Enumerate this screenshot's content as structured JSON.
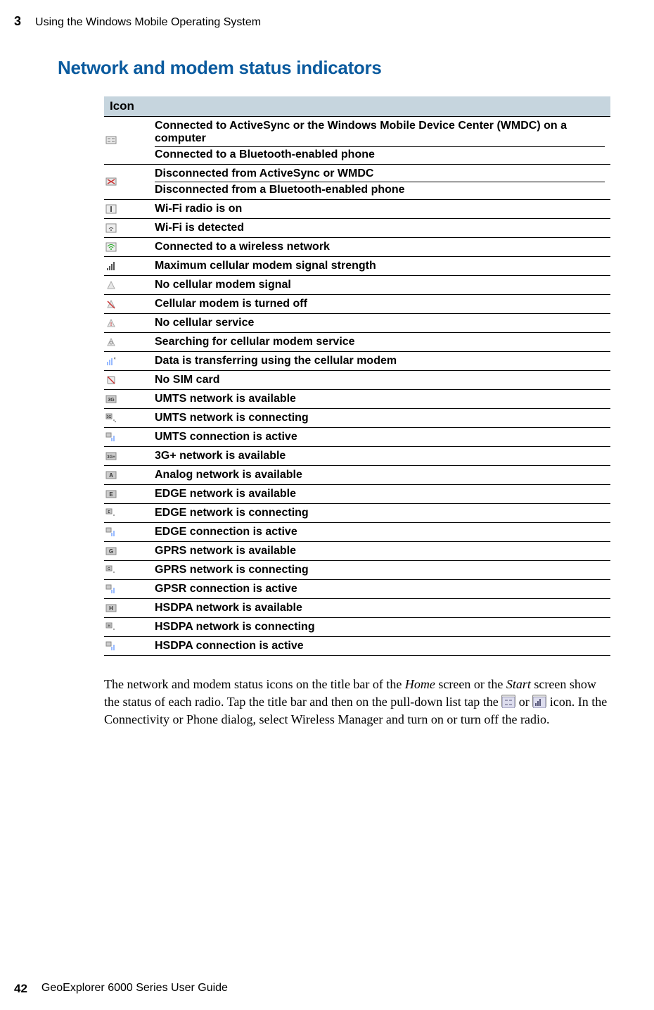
{
  "chapter_num": "3",
  "chapter_title": "Using the Windows Mobile Operating System",
  "section_title": "Network and modem status indicators",
  "table_header": "Icon",
  "rows": [
    {
      "desc_a": "Connected to ActiveSync or the Windows Mobile Device Center (WMDC) on a computer",
      "desc_b": "Connected to a Bluetooth-enabled phone"
    },
    {
      "desc_a": "Disconnected from ActiveSync or WMDC",
      "desc_b": "Disconnected from a Bluetooth-enabled phone"
    },
    {
      "desc": "Wi-Fi radio is on"
    },
    {
      "desc": "Wi-Fi is detected"
    },
    {
      "desc": "Connected to a wireless network"
    },
    {
      "desc": "Maximum cellular modem signal strength"
    },
    {
      "desc": "No cellular modem signal"
    },
    {
      "desc": "Cellular modem is turned off"
    },
    {
      "desc": "No cellular service"
    },
    {
      "desc": "Searching for cellular modem service"
    },
    {
      "desc": "Data is transferring using the cellular modem"
    },
    {
      "desc": "No SIM card"
    },
    {
      "desc": "UMTS network is available"
    },
    {
      "desc": "UMTS network is connecting"
    },
    {
      "desc": "UMTS connection is active"
    },
    {
      "desc": "3G+ network is available"
    },
    {
      "desc": "Analog network is available"
    },
    {
      "desc": "EDGE network is available"
    },
    {
      "desc": "EDGE network is connecting"
    },
    {
      "desc": "EDGE connection is active"
    },
    {
      "desc": "GPRS network is available"
    },
    {
      "desc": "GPRS network is connecting"
    },
    {
      "desc": "GPSR connection is active"
    },
    {
      "desc": "HSDPA network is available"
    },
    {
      "desc": "HSDPA network is connecting"
    },
    {
      "desc": "HSDPA connection is active"
    }
  ],
  "body": {
    "p1a": "The network and modem status icons on the title bar of the ",
    "p1_home": "Home",
    "p1b": " screen or the ",
    "p1_start": "Start",
    "p1c": " screen show the status of each radio. Tap the title bar and then on the pull-down list tap the ",
    "p1d": " or ",
    "p1e": " icon. In the Connectivity or Phone dialog, select Wireless Manager and turn on or turn off the radio."
  },
  "footer_page": "42",
  "footer_title": "GeoExplorer 6000 Series User Guide"
}
